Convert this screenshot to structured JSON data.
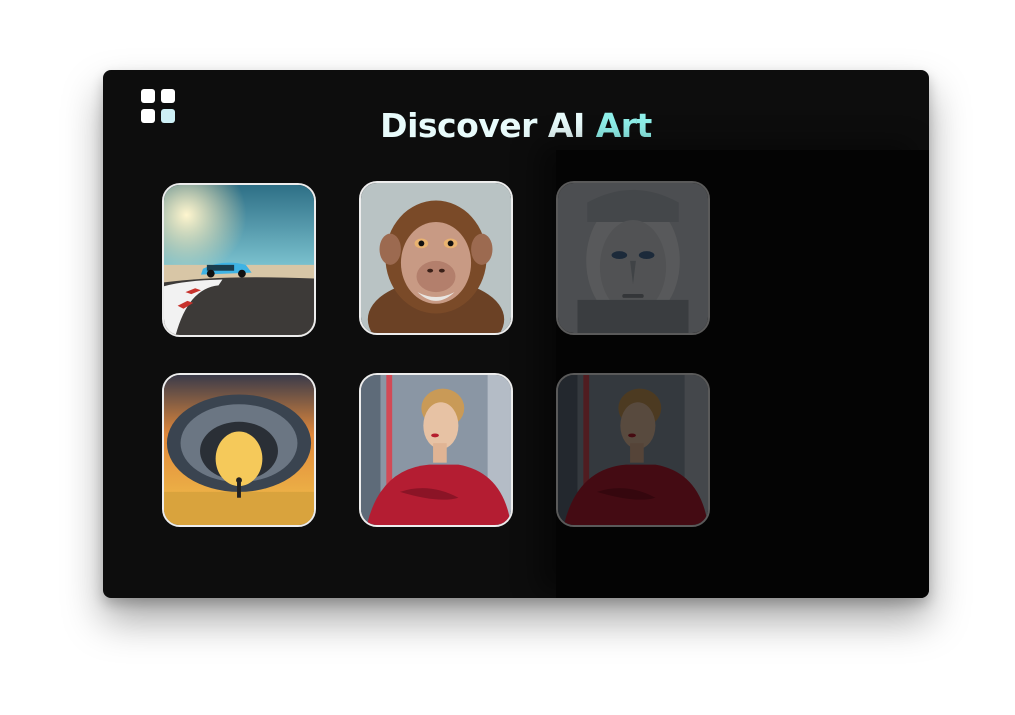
{
  "app": {
    "title_main": "Discover AI ",
    "title_accent": "Art",
    "accent_color": "#8ff0ea",
    "logo_icon": "grid-apps-icon"
  },
  "gallery": {
    "items": [
      {
        "name": "sports-car-image"
      },
      {
        "name": "chimpanzee-image"
      },
      {
        "name": "robot-face-image"
      },
      {
        "name": "portal-ring-image"
      },
      {
        "name": "woman-red-dress-image"
      },
      {
        "name": "woman-red-dress-dim-image"
      }
    ]
  }
}
